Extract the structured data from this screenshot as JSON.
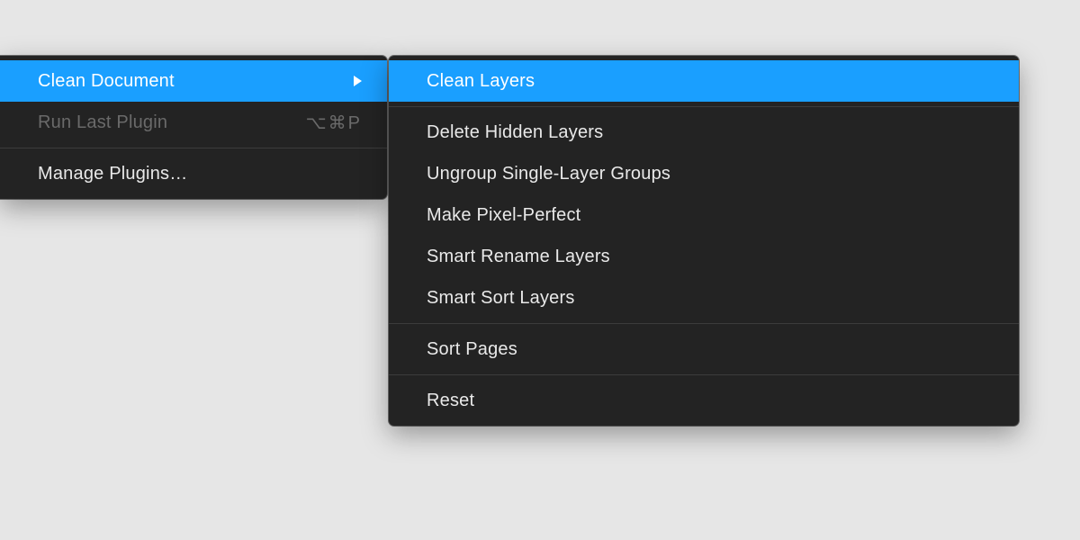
{
  "colors": {
    "highlight": "#1a9fff",
    "menuBg": "#232323",
    "pageBg": "#e6e6e6"
  },
  "primaryMenu": {
    "items": [
      {
        "label": "Clean Document",
        "hasSubmenu": true,
        "highlighted": true
      },
      {
        "label": "Run Last Plugin",
        "shortcut": "⌥⌘P",
        "disabled": true
      },
      {
        "label": "Manage Plugins…"
      }
    ]
  },
  "submenu": {
    "items": [
      {
        "label": "Clean Layers",
        "highlighted": true
      },
      {
        "label": "Delete Hidden Layers"
      },
      {
        "label": "Ungroup Single-Layer Groups"
      },
      {
        "label": "Make Pixel-Perfect"
      },
      {
        "label": "Smart Rename Layers"
      },
      {
        "label": "Smart Sort Layers"
      },
      {
        "label": "Sort Pages"
      },
      {
        "label": "Reset"
      }
    ]
  }
}
